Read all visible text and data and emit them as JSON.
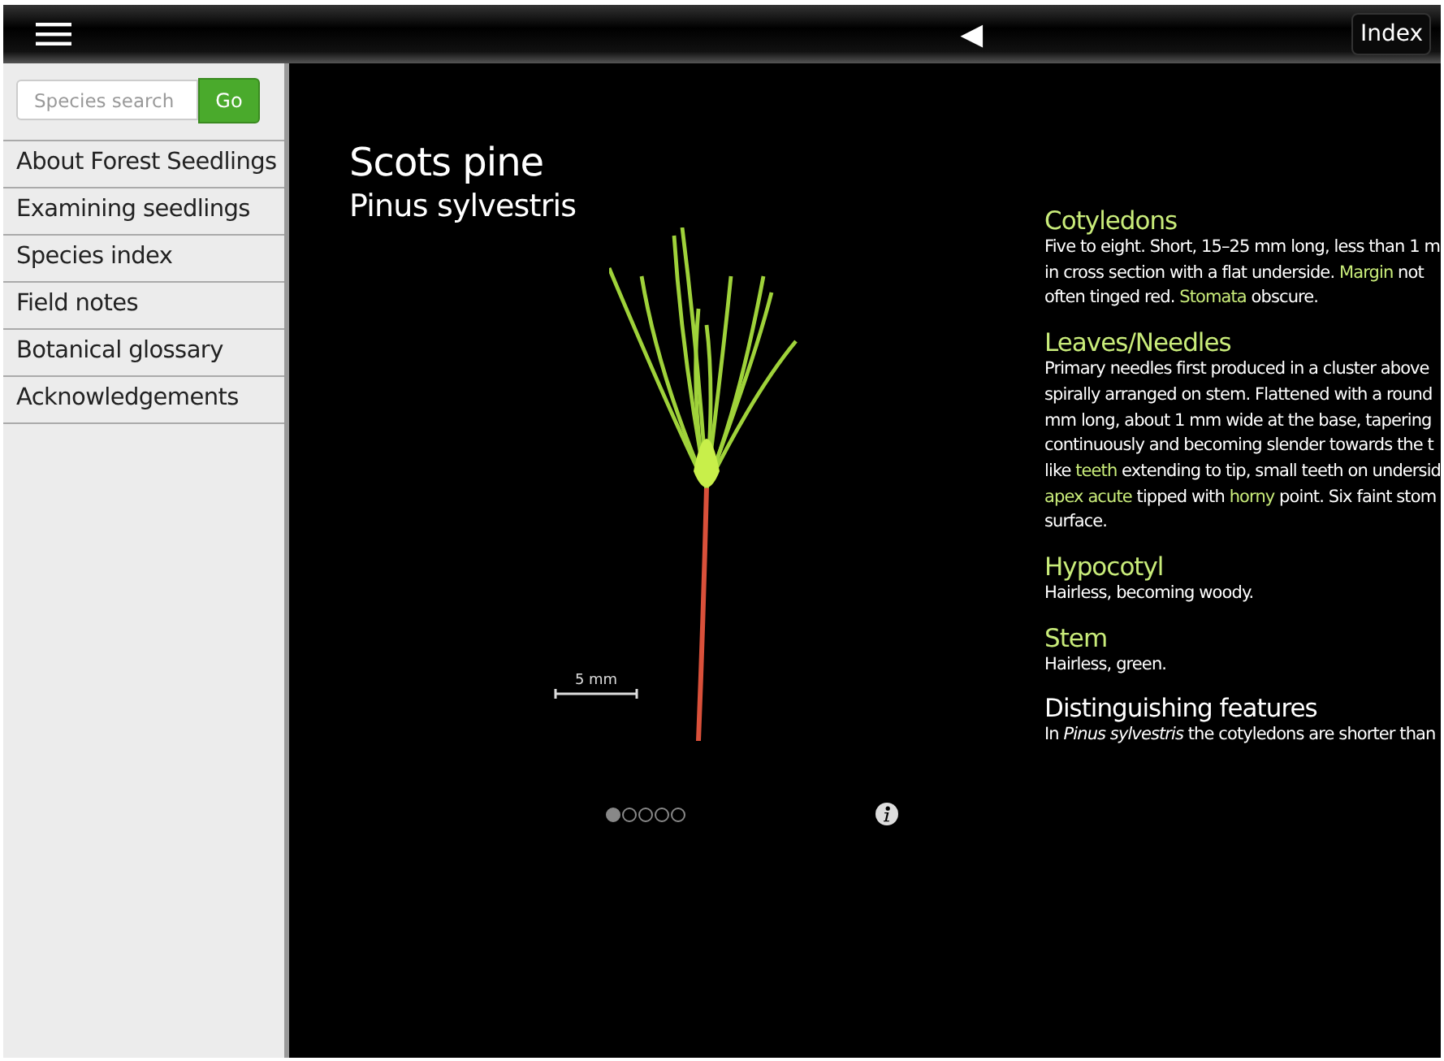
{
  "top_bar": {
    "back_symbol": "◀",
    "index_button": "Index"
  },
  "sidebar": {
    "search": {
      "placeholder": "Species search",
      "button": "Go"
    },
    "items": [
      "About Forest Seedlings",
      "Examining seedlings",
      "Species index",
      "Field notes",
      "Botanical glossary",
      "Acknowledgements"
    ]
  },
  "species": {
    "common_name": "Scots pine",
    "latin_name": "Pinus sylvestris",
    "scale_label": "5 mm",
    "pages": [
      {
        "selected": true
      },
      {
        "selected": false
      },
      {
        "selected": false
      },
      {
        "selected": false
      },
      {
        "selected": false
      }
    ]
  },
  "sections": [
    {
      "heading": "Cotyledons",
      "kind": "trait",
      "lines": [
        [
          {
            "text": "Five to eight. Short, 15–25 mm long, less than 1 m",
            "term": false
          }
        ],
        [
          {
            "text": "in cross section with a flat underside. ",
            "term": false
          },
          {
            "text": "Margin",
            "term": true
          },
          {
            "text": " not",
            "term": false
          }
        ],
        [
          {
            "text": "often tinged red. ",
            "term": false
          },
          {
            "text": "Stomata",
            "term": true
          },
          {
            "text": " obscure.",
            "term": false
          }
        ]
      ]
    },
    {
      "heading": "Leaves/Needles",
      "kind": "trait",
      "lines": [
        [
          {
            "text": "Primary needles first produced in a cluster above",
            "term": false
          }
        ],
        [
          {
            "text": "spirally arranged on stem. Flattened with a round",
            "term": false
          }
        ],
        [
          {
            "text": "mm long, about 1 mm wide at the base, tapering",
            "term": false
          }
        ],
        [
          {
            "text": "continuously and becoming slender towards the t",
            "term": false
          }
        ],
        [
          {
            "text": "like ",
            "term": false
          },
          {
            "text": "teeth",
            "term": true
          },
          {
            "text": " extending to tip, small teeth on undersid",
            "term": false
          }
        ],
        [
          {
            "text": "apex acute",
            "term": true
          },
          {
            "text": " tipped with ",
            "term": false
          },
          {
            "text": "horny",
            "term": true
          },
          {
            "text": " point. Six faint stom",
            "term": false
          }
        ],
        [
          {
            "text": "surface.",
            "term": false
          }
        ]
      ]
    },
    {
      "heading": "Hypocotyl",
      "kind": "trait",
      "lines": [
        [
          {
            "text": "Hairless, becoming woody.",
            "term": false
          }
        ]
      ]
    },
    {
      "heading": "Stem",
      "kind": "trait",
      "lines": [
        [
          {
            "text": "Hairless, green.",
            "term": false
          }
        ]
      ]
    },
    {
      "heading": "Distinguishing features",
      "kind": "summary",
      "lines": [
        [
          {
            "text": "In *Pinus sylvestris* the cotyledons are shorter than",
            "term": false
          }
        ]
      ]
    }
  ]
}
